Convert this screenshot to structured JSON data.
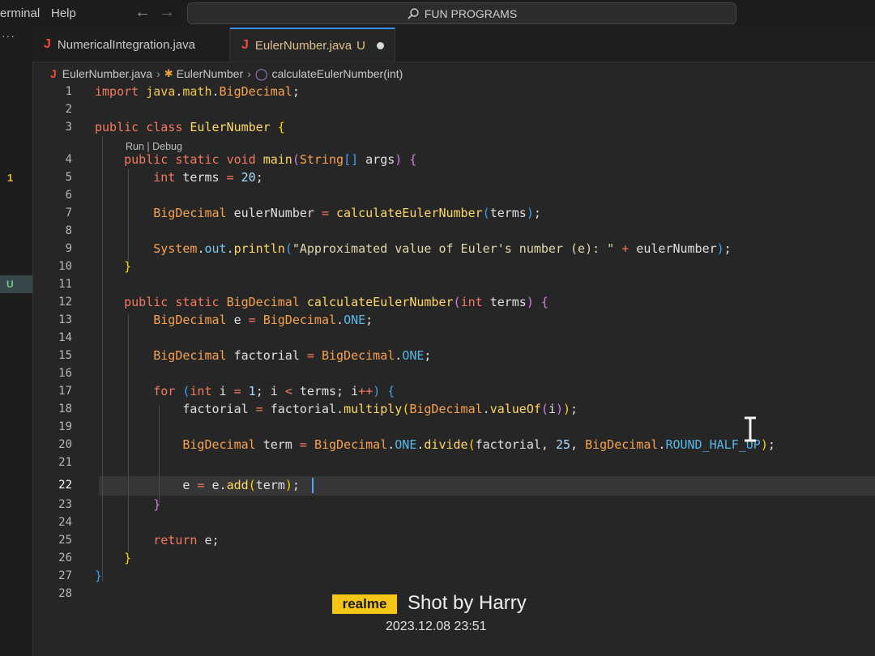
{
  "titlebar": {
    "menu": [
      "erminal",
      "Help"
    ],
    "back_icon": "arrow-left-icon",
    "forward_icon": "arrow-right-icon",
    "search_text": "FUN PROGRAMS"
  },
  "activity": {
    "dots": "···",
    "badge": "1",
    "status_u": "U"
  },
  "tabs": [
    {
      "label": "NumericalIntegration.java",
      "active": false
    },
    {
      "label": "EulerNumber.java",
      "status": "U",
      "active": true,
      "modified": true
    }
  ],
  "breadcrumb": {
    "file": "EulerNumber.java",
    "class": "EulerNumber",
    "method": "calculateEulerNumber(int)"
  },
  "codelens": "Run | Debug",
  "current_line": 22,
  "code_lines": [
    {
      "n": "1",
      "text": "import java.math.BigDecimal;"
    },
    {
      "n": "2",
      "text": ""
    },
    {
      "n": "3",
      "text": "public class EulerNumber {"
    },
    {
      "n": "4",
      "text": "    public static void main(String[] args) {"
    },
    {
      "n": "5",
      "text": "        int terms = 20;"
    },
    {
      "n": "6",
      "text": ""
    },
    {
      "n": "7",
      "text": "        BigDecimal eulerNumber = calculateEulerNumber(terms);"
    },
    {
      "n": "8",
      "text": ""
    },
    {
      "n": "9",
      "text": "        System.out.println(\"Approximated value of Euler's number (e): \" + eulerNumber);"
    },
    {
      "n": "10",
      "text": "    }"
    },
    {
      "n": "11",
      "text": ""
    },
    {
      "n": "12",
      "text": "    public static BigDecimal calculateEulerNumber(int terms) {"
    },
    {
      "n": "13",
      "text": "        BigDecimal e = BigDecimal.ONE;"
    },
    {
      "n": "14",
      "text": ""
    },
    {
      "n": "15",
      "text": "        BigDecimal factorial = BigDecimal.ONE;"
    },
    {
      "n": "16",
      "text": ""
    },
    {
      "n": "17",
      "text": "        for (int i = 1; i < terms; i++) {"
    },
    {
      "n": "18",
      "text": "            factorial = factorial.multiply(BigDecimal.valueOf(i));"
    },
    {
      "n": "19",
      "text": ""
    },
    {
      "n": "20",
      "text": "            BigDecimal term = BigDecimal.ONE.divide(factorial, 25, BigDecimal.ROUND_HALF_UP);"
    },
    {
      "n": "21",
      "text": ""
    },
    {
      "n": "22",
      "text": "            e = e.add(term);"
    },
    {
      "n": "23",
      "text": "        }"
    },
    {
      "n": "24",
      "text": ""
    },
    {
      "n": "25",
      "text": "        return e;"
    },
    {
      "n": "26",
      "text": "    }"
    },
    {
      "n": "27",
      "text": "}"
    },
    {
      "n": "28",
      "text": ""
    }
  ],
  "watermark": {
    "brand": "realme",
    "shot": "Shot by Harry",
    "datetime": "2023.12.08 23:51"
  },
  "colors": {
    "accent": "#3b8eea",
    "modified": "#e2c08d",
    "java_icon": "#f04a3a",
    "watermark_brand_bg": "#f5c518"
  }
}
